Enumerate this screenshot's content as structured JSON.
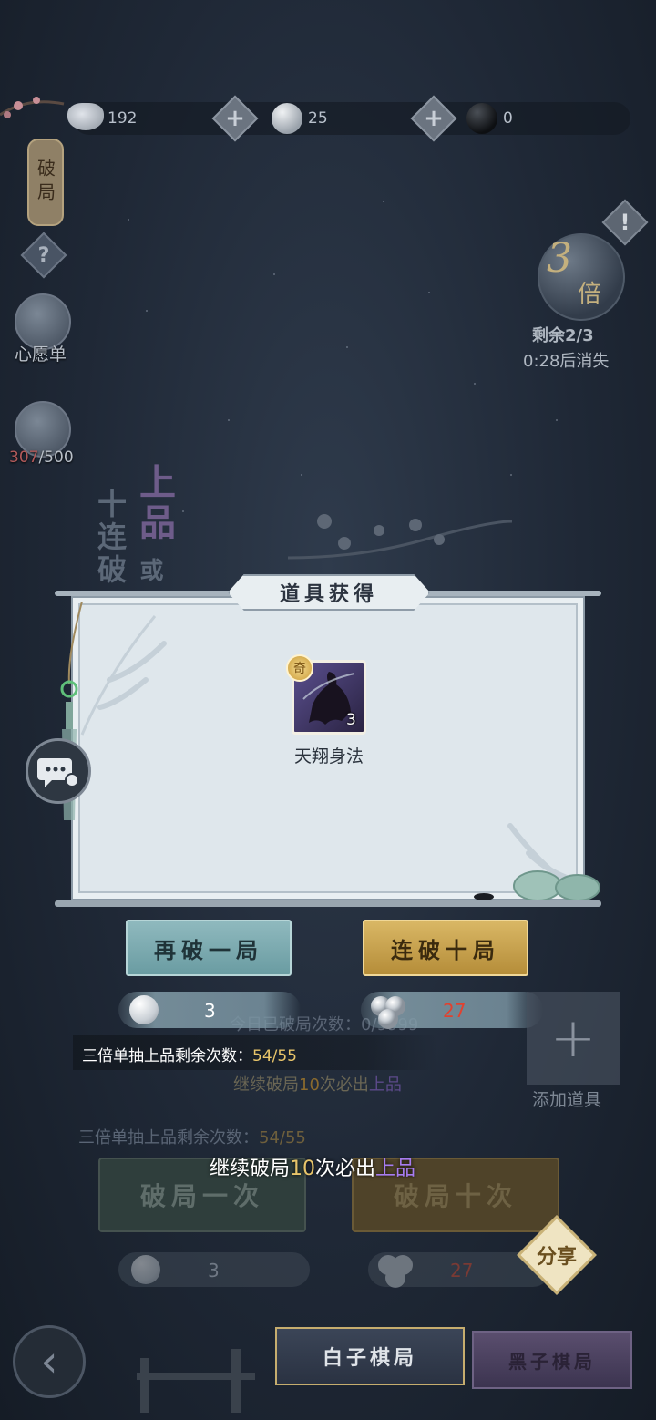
{
  "resources": {
    "silver": "192",
    "white_stone": "25",
    "black_stone": "0"
  },
  "left_panel": {
    "lantern_label": "破局",
    "help_label": "?",
    "wishlist_label": "心愿单",
    "progress_current": "307",
    "progress_total": "/500"
  },
  "right_panel": {
    "warning_label": "!",
    "multiplier_value": "3",
    "multiplier_unit": "倍",
    "remaining": "剩余2/3",
    "countdown": "0:28后消失"
  },
  "background": {
    "ten_draw": "十连破",
    "top_grade": "上品",
    "small_char": "或",
    "daily_count_label": "今日已破局次数：",
    "daily_count_value": "0/9999",
    "bg_guarantee_prefix": "继续破局",
    "bg_guarantee_num": "10",
    "bg_guarantee_mid": "次必出",
    "bg_guarantee_grade": "上品",
    "bg_remaining_label": "三倍单抽上品剩余次数：",
    "bg_remaining_value": "54/55",
    "bg_btn_once": "破局一次",
    "bg_btn_ten": "破局十次",
    "bg_cost_once": "3",
    "bg_cost_ten": "27",
    "add_item_label": "添加道具",
    "add_item_icon": "+"
  },
  "dialog": {
    "title": "道具获得",
    "item_name": "天翔身法",
    "item_count": "3",
    "item_badge": "奇",
    "btn_again": "再破一局",
    "btn_ten": "连破十局",
    "cost_again": "3",
    "cost_ten": "27"
  },
  "info": {
    "remaining_label": "三倍单抽上品剩余次数：",
    "remaining_value": "54/55",
    "guarantee_prefix": "继续破局",
    "guarantee_num": "10",
    "guarantee_mid": "次必出",
    "guarantee_grade": "上品"
  },
  "bottom": {
    "share_label": "分享",
    "back_icon": "back-arrow-icon",
    "tab_white": "白子棋局",
    "tab_black": "黑子棋局"
  },
  "colors": {
    "gold": "#e8c56a",
    "purple": "#a77cf0",
    "red": "#e2412f",
    "dialog_bg": "#dfe7ec"
  }
}
